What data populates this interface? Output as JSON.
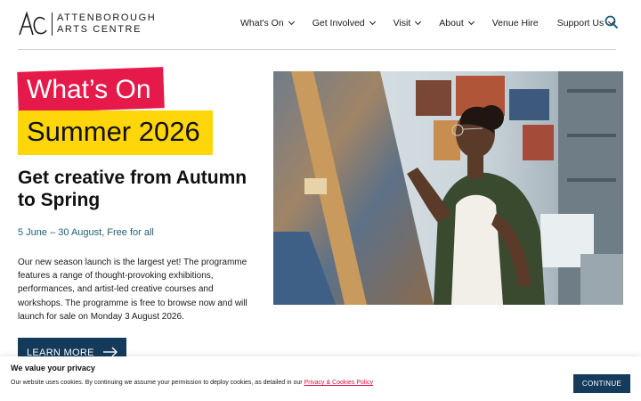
{
  "header": {
    "logo_line1": "ATTENBOROUGH",
    "logo_line2": "ARTS CENTRE",
    "nav": [
      {
        "label": "What's On",
        "icon": "chevron-down-icon"
      },
      {
        "label": "Get Involved",
        "icon": "chevron-down-icon"
      },
      {
        "label": "Visit",
        "icon": "chevron-down-icon"
      },
      {
        "label": "About",
        "icon": "chevron-down-icon"
      },
      {
        "label": "Venue Hire",
        "icon": ""
      },
      {
        "label": "Support Us",
        "icon": "chevron-down-icon"
      }
    ],
    "search_icon": "search-icon"
  },
  "hero": {
    "tag_primary": "What’s On",
    "tag_secondary": "Summer 2026",
    "title": "Get creative from Autumn to Spring",
    "date": "5 June – 30 August, Free for all",
    "body": "Our new season launch is the largest yet! The programme features a range of thought-provoking exhibitions, performances, and artist-led creative courses and workshops. The programme is free to browse now and will launch for sale on Monday 3 August 2026.",
    "cta_label": "LEARN MORE"
  },
  "cookie": {
    "title": "We value your privacy",
    "text": "Our website uses cookies. By continuing we assume your permission to deploy cookies, as detailed in our",
    "link": "Privacy & Cookies Policy",
    "button": "CONTINUE"
  },
  "colors": {
    "accent_red": "#e5194a",
    "accent_yellow": "#ffd60a",
    "navy": "#143a5c",
    "teal_text": "#1d5f73"
  }
}
